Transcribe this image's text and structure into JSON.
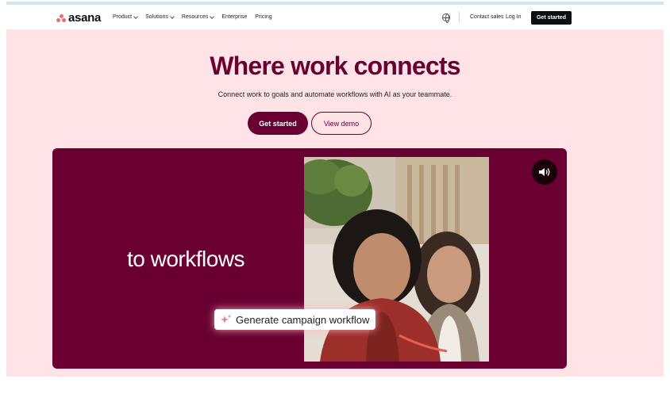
{
  "brand": {
    "name": "asana",
    "logo_color": "#f06a6a"
  },
  "nav": {
    "items": [
      {
        "label": "Product",
        "dropdown": true
      },
      {
        "label": "Solutions",
        "dropdown": true
      },
      {
        "label": "Resources",
        "dropdown": true
      },
      {
        "label": "Enterprise",
        "dropdown": false
      },
      {
        "label": "Pricing",
        "dropdown": false
      }
    ],
    "globe_icon": "globe-icon",
    "contact_label": "Contact sales",
    "login_label": "Log In",
    "cta_label": "Get started"
  },
  "hero": {
    "title": "Where work connects",
    "subtitle": "Connect work to goals and automate workflows with AI as your teammate.",
    "primary_button": "Get started",
    "secondary_button": "View demo",
    "background_color": "#ffe3e6",
    "accent_color": "#690031"
  },
  "video": {
    "caption": "to workflows",
    "chip_label": "Generate campaign workflow",
    "chip_icon": "sparkle-icon",
    "sound_icon": "speaker-icon"
  }
}
